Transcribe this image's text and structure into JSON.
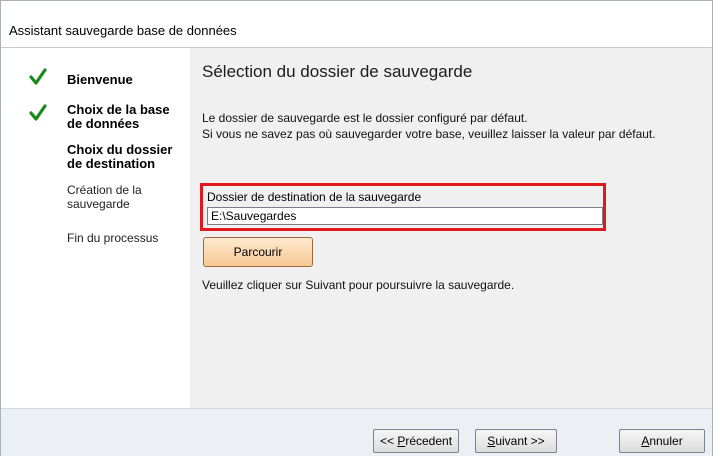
{
  "window": {
    "title": "Assistant sauvegarde base de données"
  },
  "steps": [
    {
      "line1": "Bienvenue",
      "line2": "",
      "done": true
    },
    {
      "line1": "Choix de la base",
      "line2": "de données",
      "done": true
    },
    {
      "line1": "Choix du dossier",
      "line2": "de destination",
      "done": false
    },
    {
      "line1": "Création de la",
      "line2": "sauvegarde",
      "done": false
    },
    {
      "line1": "Fin du processus",
      "line2": "",
      "done": false
    }
  ],
  "main": {
    "heading": "Sélection du dossier de sauvegarde",
    "desc_line1": "Le dossier de sauvegarde est le dossier configuré par défaut.",
    "desc_line2": "Si vous ne savez pas où sauvegarder votre base,  veuillez laisser la valeur par défaut.",
    "dest_label": "Dossier de destination de la sauvegarde",
    "dest_value": "E:\\Sauvegardes",
    "browse_label": "Parcourir",
    "continue_text": "Veuillez cliquer sur Suivant pour poursuivre la sauvegarde."
  },
  "footer": {
    "prev_prefix": "<< ",
    "prev_mnemonic": "P",
    "prev_rest": "récedent",
    "next_mnemonic": "S",
    "next_rest": "uivant >>",
    "cancel_mnemonic": "A",
    "cancel_rest": "nnuler"
  },
  "colors": {
    "check": "#1a8a1a",
    "highlight": "#e0191f",
    "browse": "#f7c994"
  }
}
